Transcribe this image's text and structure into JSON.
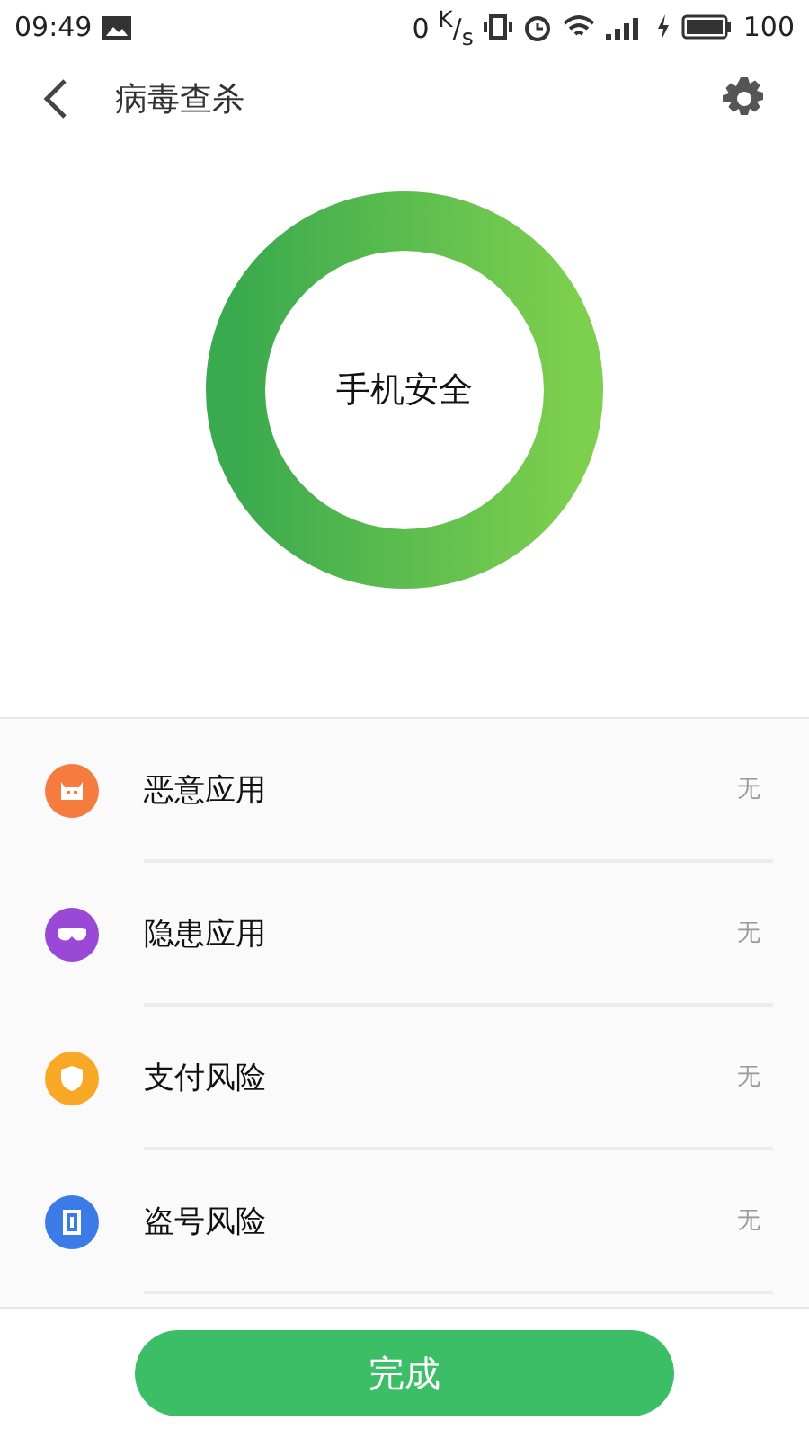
{
  "status_bar": {
    "time": "09:49",
    "speed": "0 $^{K}$/$_{s}$",
    "battery": "100"
  },
  "header": {
    "title": "病毒查杀"
  },
  "status": {
    "label": "手机安全",
    "level": 1
  },
  "risks": [
    {
      "label": "恶意应用",
      "value": "无",
      "color": "#f57c3e",
      "kind": "robot"
    },
    {
      "label": "隐患应用",
      "value": "无",
      "color": "#9a49d6",
      "kind": "mask"
    },
    {
      "label": "支付风险",
      "value": "无",
      "color": "#f9a825",
      "kind": "shield"
    },
    {
      "label": "盗号风险",
      "value": "无",
      "color": "#3b7be8",
      "kind": "phone"
    }
  ],
  "done_button": "完成"
}
